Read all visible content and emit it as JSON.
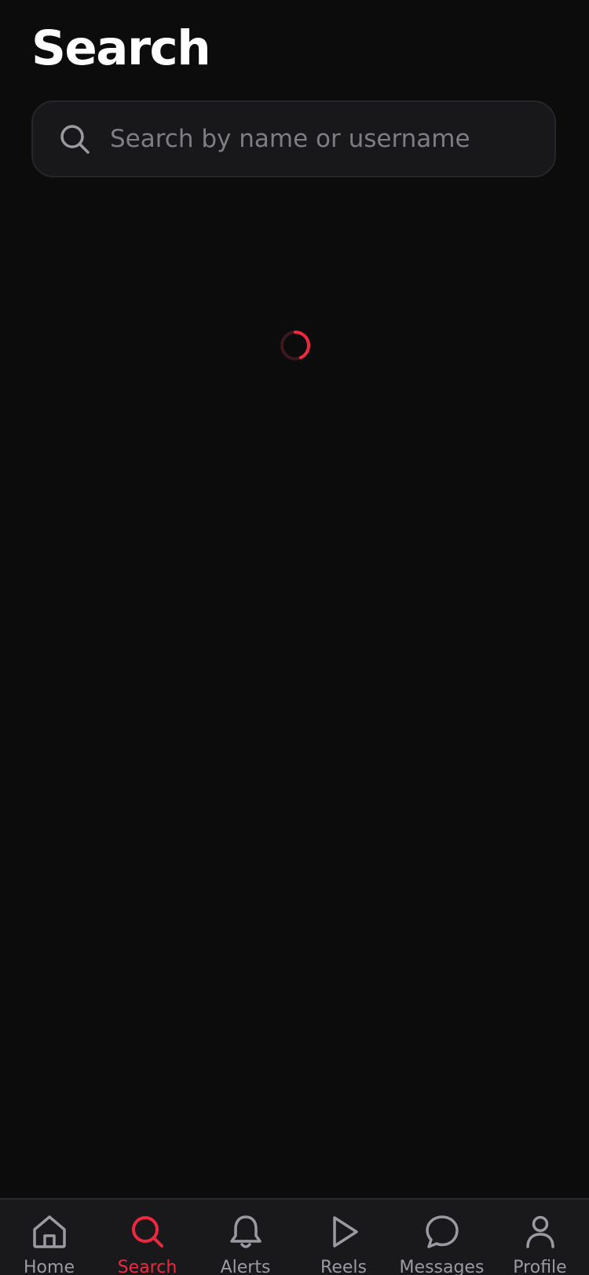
{
  "header": {
    "title": "Search"
  },
  "search": {
    "placeholder": "Search by name or username",
    "value": ""
  },
  "colors": {
    "background": "#0c0c0d",
    "accent": "#f0283f",
    "nav_inactive": "#9a9aa0",
    "field_background": "#18181b"
  },
  "status": {
    "loading": true
  },
  "nav": {
    "active": "search",
    "items": [
      {
        "id": "home",
        "label": "Home",
        "icon": "home-icon"
      },
      {
        "id": "search",
        "label": "Search",
        "icon": "search-icon"
      },
      {
        "id": "alerts",
        "label": "Alerts",
        "icon": "bell-icon"
      },
      {
        "id": "reels",
        "label": "Reels",
        "icon": "play-icon"
      },
      {
        "id": "messages",
        "label": "Messages",
        "icon": "chat-bubble-icon"
      },
      {
        "id": "profile",
        "label": "Profile",
        "icon": "user-icon"
      }
    ]
  }
}
